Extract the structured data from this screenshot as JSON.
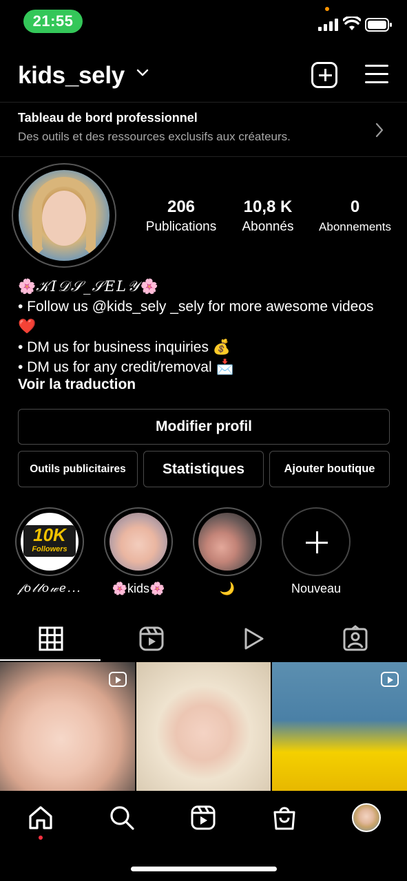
{
  "status_bar": {
    "time": "21:55",
    "time_pill_color": "#34c759",
    "indicators": [
      "signal-icon",
      "wifi-icon",
      "battery-icon"
    ]
  },
  "header": {
    "username": "kids_sely",
    "actions": [
      "add-post-icon",
      "menu-icon"
    ]
  },
  "pro_dashboard": {
    "title": "Tableau de bord professionnel",
    "subtitle": "Des outils et des ressources exclusifs aux créateurs."
  },
  "stats": [
    {
      "value": "206",
      "label": "Publications"
    },
    {
      "value": "10,8 K",
      "label": "Abonnés"
    },
    {
      "value": "0",
      "label": "Abonnements"
    }
  ],
  "bio": {
    "name_emoji": "🌸",
    "name": "𝒦𝐼𝒟𝒮_𝒮𝐸𝐿𝒴",
    "line1": "• Follow us @kids_sely _sely for more awesome videos ",
    "line1_emoji": "❤️",
    "line2": "• DM us for business inquiries ",
    "line2_emoji": "💰",
    "line3": "• DM us for any credit/removal ",
    "line3_emoji": "📩",
    "translate_link": "Voir la traduction"
  },
  "buttons": {
    "edit_profile": "Modifier profil",
    "ad_tools": "Outils publicitaires",
    "statistics": "Statistiques",
    "add_shop": "Ajouter boutique"
  },
  "highlights": [
    {
      "label": "𝒻𝑜𝓁𝓁𝑜𝓌𝑒...",
      "badge_big": "10K",
      "badge_small": "Followers"
    },
    {
      "label": "🌸kids🌸"
    },
    {
      "label": "🌙"
    },
    {
      "label": "Nouveau"
    }
  ],
  "tabs": [
    "grid-icon",
    "reels-icon",
    "video-play-icon",
    "tagged-icon"
  ],
  "bottom_nav": [
    "home-icon",
    "search-icon",
    "reels-icon",
    "shop-icon",
    "profile-avatar"
  ],
  "accent_colors": {
    "notification_dot": "#ff3040",
    "badge_gold": "#f2c200"
  }
}
